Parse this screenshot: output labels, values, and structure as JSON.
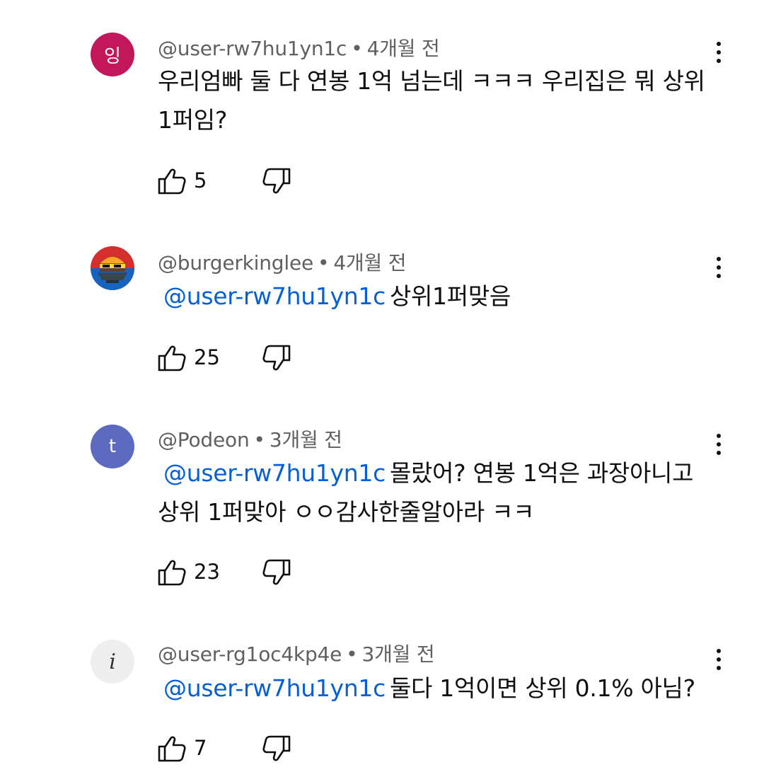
{
  "comments": [
    {
      "avatar_text": "잉",
      "avatar_color": "#c2185b",
      "username": "@user-rw7hu1yn1c",
      "separator": "•",
      "time": "4개월 전",
      "mention": "",
      "text": "우리엄빠 둘 다 연봉 1억 넘는데 ㅋㅋㅋ 우리집은 뭐 상위 1퍼임?",
      "likes": "5"
    },
    {
      "avatar_text": "",
      "avatar_color": "#c62828",
      "username": "@burgerkinglee",
      "separator": "•",
      "time": "4개월 전",
      "mention": "@user-rw7hu1yn1c",
      "text": "상위1퍼맞음",
      "likes": "25"
    },
    {
      "avatar_text": "t",
      "avatar_color": "#5c6bc0",
      "username": "@Podeon",
      "separator": "•",
      "time": "3개월 전",
      "mention": "@user-rw7hu1yn1c",
      "text": "몰랐어? 연봉 1억은 과장아니고 상위 1퍼맞아 ㅇㅇ감사한줄알아라 ㅋㅋ",
      "likes": "23"
    },
    {
      "avatar_text": "i",
      "avatar_color": "#eeeeee",
      "username": "@user-rg1oc4kp4e",
      "separator": "•",
      "time": "3개월 전",
      "mention": "@user-rw7hu1yn1c",
      "text": "둘다 1억이면 상위 0.1% 아님?",
      "likes": "7"
    }
  ],
  "colors": {
    "mention": "#065fd4",
    "meta": "#606060",
    "text": "#0f0f0f"
  },
  "icons": {
    "like": "thumbs-up-icon",
    "dislike": "thumbs-down-icon",
    "more": "more-vertical-icon"
  }
}
